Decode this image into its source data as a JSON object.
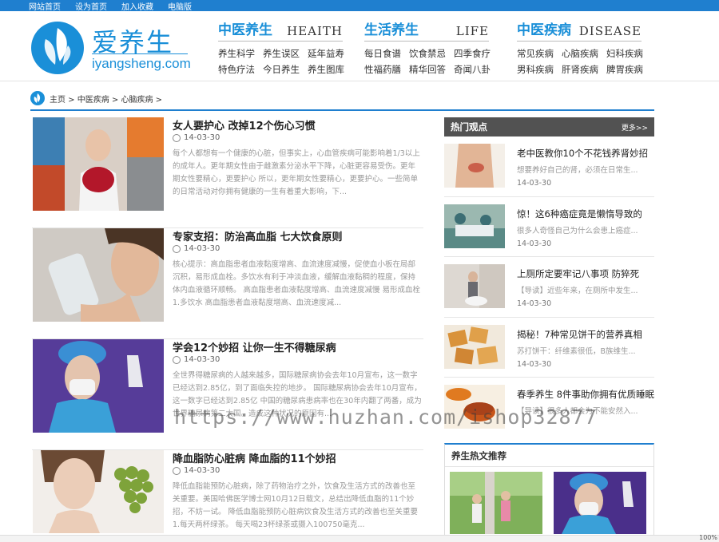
{
  "topbar": {
    "links": [
      "网站首页",
      "设为首页",
      "加入收藏",
      "电脑版"
    ]
  },
  "logo": {
    "cn": "爱养生",
    "en": "iyangsheng.com"
  },
  "nav": [
    {
      "cn": "中医养生",
      "en": "HEAITH",
      "links": [
        "养生科学",
        "养生误区",
        "延年益寿",
        "特色疗法",
        "今日养生",
        "养生图库"
      ]
    },
    {
      "cn": "生活养生",
      "en": "LIFE",
      "links": [
        "每日食谱",
        "饮食禁忌",
        "四季食疗",
        "性福药膳",
        "精华回答",
        "奇闻八卦"
      ]
    },
    {
      "cn": "中医疾病",
      "en": "DISEASE",
      "links": [
        "常见疾病",
        "心脑疾病",
        "妇科疾病",
        "男科疾病",
        "肝肾疾病",
        "脾胃疾病"
      ]
    }
  ],
  "breadcrumb": "主页 > 中医疾病 > 心脑疾病 >",
  "articles": [
    {
      "title": "女人要护心 改掉12个伤心习惯",
      "date": "14-03-30",
      "desc": "每个人都想有一个健康的心脏，但事实上，心血管疾病可能影响着1/3以上的成年人。更年期女性由于雌激素分泌水平下降，心脏更容易受伤。更年期女性要精心，更要护心 所以，更年期女性要精心，更要护心。一些简单的日常活动对你拥有健康的一生有着重大影响，下..."
    },
    {
      "title": "专家支招：防治高血脂 七大饮食原则",
      "date": "14-03-30",
      "desc": "核心提示：高血脂患者血液黏度增高、血流速度减慢，促使血小板在局部沉积，易形成血栓。多饮水有利于冲淡血液，缓解血液黏稠的程度，保持体内血液循环顺畅。 高血脂患者血液黏度增高、血流速度减慢 易形成血栓 1.多饮水 高血脂患者血液黏度增高、血流速度减..."
    },
    {
      "title": "学会12个妙招 让你一生不得糖尿病",
      "date": "14-03-30",
      "desc": "全世界得糖尿病的人越来越多，国际糖尿病协会去年10月宣布，这一数字已经达到2.85亿，到了面临失控的地步。 国际糖尿病协会去年10月宣布，这一数字已经达到2.85亿 中国的糖尿病患病率也在30年内翻了两番，成为世界糖尿病第二大国。造成这种状况的原因有..."
    },
    {
      "title": "降血脂防心脏病 降血脂的11个妙招",
      "date": "14-03-30",
      "desc": "降低血脂能预防心脏病，除了药物治疗之外，饮食及生活方式的改善也至关重要。美国哈佛医学博士网10月12日载文，总结出降低血脂的11个妙招，不妨一试。 降低血脂能预防心脏病饮食及生活方式的改善也至关重要 1.每天两杯绿茶。 每天喝23杯绿茶或摄入100750毫克..."
    }
  ],
  "sidebar": {
    "title": "热门观点",
    "more": "更多>>",
    "items": [
      {
        "title": "老中医教你10个不花钱养肾妙招",
        "desc": "想要养好自己的肾，必须在日常生...",
        "date": "14-03-30"
      },
      {
        "title": "惊！这6种癌症竟是懒惰导致的",
        "desc": "很多人奇怪自己为什么会患上癌症...",
        "date": "14-03-30"
      },
      {
        "title": "上厕所定要牢记八事项 防猝死",
        "desc": "【导读】近些年来，在厕所中发生...",
        "date": "14-03-30"
      },
      {
        "title": "揭秘！7种常见饼干的营养真相",
        "desc": "苏打饼干：纤维素很低，B族维生...",
        "date": "14-03-30"
      },
      {
        "title": "春季养生 8件事助你拥有优质睡眠",
        "desc": "【导读】很多人都会为不能安然入...",
        "date": "14-03-30"
      }
    ]
  },
  "recommend": {
    "title": "养生热文推荐"
  },
  "watermark": "https://www.huzhan.com/ishop32877",
  "statusbar": {
    "zoom": "100%"
  }
}
